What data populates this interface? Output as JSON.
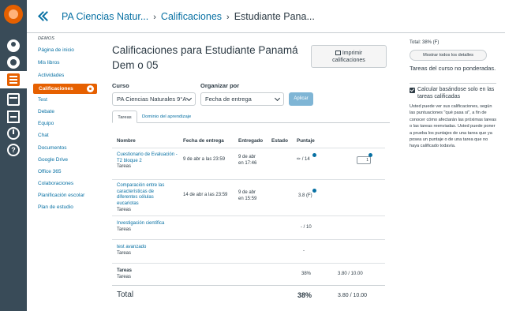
{
  "global_nav": {
    "help_glyph": "?"
  },
  "header": {
    "breadcrumbs": [
      "PA Ciencias Natur...",
      "Calificaciones",
      "Estudiante Pana..."
    ],
    "separator": "›"
  },
  "course_nav": {
    "term": "DEMOS",
    "items": [
      {
        "label": "Página de inicio"
      },
      {
        "label": "Mis libros"
      },
      {
        "label": "Actividades"
      },
      {
        "label": "Calificaciones"
      },
      {
        "label": "Test"
      },
      {
        "label": "Debate"
      },
      {
        "label": "Equipo"
      },
      {
        "label": "Chat"
      },
      {
        "label": "Documentos"
      },
      {
        "label": "Google Drive"
      },
      {
        "label": "Office 365"
      },
      {
        "label": "Colaboraciones"
      },
      {
        "label": "Planificación escolar"
      },
      {
        "label": "Plan de estudio"
      }
    ]
  },
  "main": {
    "title": "Calificaciones para Estudiante Panamá Dem o 05",
    "print_button": {
      "line1": "Imprimir",
      "line2": "calificaciones"
    },
    "course_label": "Curso",
    "course_value": "PA Ciencias Naturales 9°A",
    "order_label": "Organizar por",
    "order_value": "Fecha de entrega",
    "apply_label": "Aplicar",
    "tabs": [
      "Tareas",
      "Dominio del aprendizaje"
    ],
    "columns": [
      "Nombre",
      "Fecha de entrega",
      "Entregado",
      "Estado",
      "Puntaje"
    ],
    "rows": [
      {
        "name": "Cuestionario de Evaluación - T2 bloque 2",
        "group": "Tareas",
        "due": "9 de abr a las 23:59",
        "submitted_line1": "9 de abr",
        "submitted_line2": "en 17:46",
        "status": "",
        "score": "/ 14",
        "rubric_count": "1"
      },
      {
        "name": "Comparación entre las características de diferentes células eucariotas",
        "group": "Tareas",
        "due": "14 de abr a las 23:59",
        "submitted_line1": "9 de abr",
        "submitted_line2": "en 15:59",
        "status": "",
        "score": "3.8 (F)"
      },
      {
        "name": "Investigación científica",
        "group": "Tareas",
        "due": "",
        "submitted_line1": "",
        "submitted_line2": "",
        "status": "",
        "score": "- / 10"
      },
      {
        "name": "test avanzado",
        "group": "Tareas",
        "due": "",
        "submitted_line1": "",
        "submitted_line2": "",
        "status": "",
        "score": "-"
      }
    ],
    "group_total": {
      "name": "Tareas",
      "group": "Tareas",
      "percent": "38%",
      "points": "3.80 / 10.00"
    },
    "total": {
      "label": "Total",
      "percent": "38%",
      "points": "3.80 / 10.00"
    }
  },
  "sidebar": {
    "total": "Total: 38% (F)",
    "show_all": "Mostrar todos los detalles",
    "unweighted": "Tareas del curso no ponderadas.",
    "checkbox_label": "Calcular basándose solo en las tareas calificadas",
    "checkbox_checked": true,
    "note": "Usted puede ver sus calificaciones, según las puntuaciones \"qué pasa si\", a fin de conocer cómo afectarán las próximas tareas o las tareas reenviadas. Usted puede poner a prueba los puntajes de una tarea que ya posea un puntaje o de una tarea que no haya calificado todavía."
  },
  "colors": {
    "global_nav_bg": "#394b58",
    "brand_orange": "#e66000",
    "link_blue": "#0770a3",
    "text": "#2d3b45"
  }
}
